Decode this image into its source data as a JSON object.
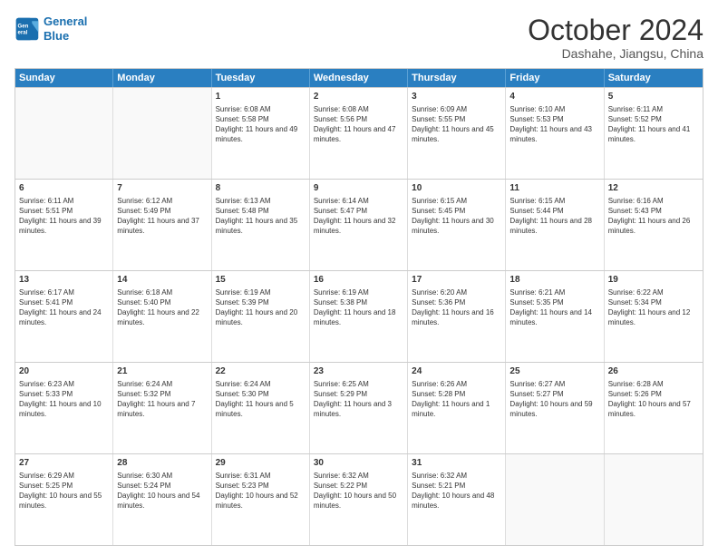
{
  "header": {
    "logo_line1": "General",
    "logo_line2": "Blue",
    "title": "October 2024",
    "subtitle": "Dashahe, Jiangsu, China"
  },
  "days_of_week": [
    "Sunday",
    "Monday",
    "Tuesday",
    "Wednesday",
    "Thursday",
    "Friday",
    "Saturday"
  ],
  "weeks": [
    [
      {
        "day": "",
        "sunrise": "",
        "sunset": "",
        "daylight": ""
      },
      {
        "day": "",
        "sunrise": "",
        "sunset": "",
        "daylight": ""
      },
      {
        "day": "1",
        "sunrise": "Sunrise: 6:08 AM",
        "sunset": "Sunset: 5:58 PM",
        "daylight": "Daylight: 11 hours and 49 minutes."
      },
      {
        "day": "2",
        "sunrise": "Sunrise: 6:08 AM",
        "sunset": "Sunset: 5:56 PM",
        "daylight": "Daylight: 11 hours and 47 minutes."
      },
      {
        "day": "3",
        "sunrise": "Sunrise: 6:09 AM",
        "sunset": "Sunset: 5:55 PM",
        "daylight": "Daylight: 11 hours and 45 minutes."
      },
      {
        "day": "4",
        "sunrise": "Sunrise: 6:10 AM",
        "sunset": "Sunset: 5:53 PM",
        "daylight": "Daylight: 11 hours and 43 minutes."
      },
      {
        "day": "5",
        "sunrise": "Sunrise: 6:11 AM",
        "sunset": "Sunset: 5:52 PM",
        "daylight": "Daylight: 11 hours and 41 minutes."
      }
    ],
    [
      {
        "day": "6",
        "sunrise": "Sunrise: 6:11 AM",
        "sunset": "Sunset: 5:51 PM",
        "daylight": "Daylight: 11 hours and 39 minutes."
      },
      {
        "day": "7",
        "sunrise": "Sunrise: 6:12 AM",
        "sunset": "Sunset: 5:49 PM",
        "daylight": "Daylight: 11 hours and 37 minutes."
      },
      {
        "day": "8",
        "sunrise": "Sunrise: 6:13 AM",
        "sunset": "Sunset: 5:48 PM",
        "daylight": "Daylight: 11 hours and 35 minutes."
      },
      {
        "day": "9",
        "sunrise": "Sunrise: 6:14 AM",
        "sunset": "Sunset: 5:47 PM",
        "daylight": "Daylight: 11 hours and 32 minutes."
      },
      {
        "day": "10",
        "sunrise": "Sunrise: 6:15 AM",
        "sunset": "Sunset: 5:45 PM",
        "daylight": "Daylight: 11 hours and 30 minutes."
      },
      {
        "day": "11",
        "sunrise": "Sunrise: 6:15 AM",
        "sunset": "Sunset: 5:44 PM",
        "daylight": "Daylight: 11 hours and 28 minutes."
      },
      {
        "day": "12",
        "sunrise": "Sunrise: 6:16 AM",
        "sunset": "Sunset: 5:43 PM",
        "daylight": "Daylight: 11 hours and 26 minutes."
      }
    ],
    [
      {
        "day": "13",
        "sunrise": "Sunrise: 6:17 AM",
        "sunset": "Sunset: 5:41 PM",
        "daylight": "Daylight: 11 hours and 24 minutes."
      },
      {
        "day": "14",
        "sunrise": "Sunrise: 6:18 AM",
        "sunset": "Sunset: 5:40 PM",
        "daylight": "Daylight: 11 hours and 22 minutes."
      },
      {
        "day": "15",
        "sunrise": "Sunrise: 6:19 AM",
        "sunset": "Sunset: 5:39 PM",
        "daylight": "Daylight: 11 hours and 20 minutes."
      },
      {
        "day": "16",
        "sunrise": "Sunrise: 6:19 AM",
        "sunset": "Sunset: 5:38 PM",
        "daylight": "Daylight: 11 hours and 18 minutes."
      },
      {
        "day": "17",
        "sunrise": "Sunrise: 6:20 AM",
        "sunset": "Sunset: 5:36 PM",
        "daylight": "Daylight: 11 hours and 16 minutes."
      },
      {
        "day": "18",
        "sunrise": "Sunrise: 6:21 AM",
        "sunset": "Sunset: 5:35 PM",
        "daylight": "Daylight: 11 hours and 14 minutes."
      },
      {
        "day": "19",
        "sunrise": "Sunrise: 6:22 AM",
        "sunset": "Sunset: 5:34 PM",
        "daylight": "Daylight: 11 hours and 12 minutes."
      }
    ],
    [
      {
        "day": "20",
        "sunrise": "Sunrise: 6:23 AM",
        "sunset": "Sunset: 5:33 PM",
        "daylight": "Daylight: 11 hours and 10 minutes."
      },
      {
        "day": "21",
        "sunrise": "Sunrise: 6:24 AM",
        "sunset": "Sunset: 5:32 PM",
        "daylight": "Daylight: 11 hours and 7 minutes."
      },
      {
        "day": "22",
        "sunrise": "Sunrise: 6:24 AM",
        "sunset": "Sunset: 5:30 PM",
        "daylight": "Daylight: 11 hours and 5 minutes."
      },
      {
        "day": "23",
        "sunrise": "Sunrise: 6:25 AM",
        "sunset": "Sunset: 5:29 PM",
        "daylight": "Daylight: 11 hours and 3 minutes."
      },
      {
        "day": "24",
        "sunrise": "Sunrise: 6:26 AM",
        "sunset": "Sunset: 5:28 PM",
        "daylight": "Daylight: 11 hours and 1 minute."
      },
      {
        "day": "25",
        "sunrise": "Sunrise: 6:27 AM",
        "sunset": "Sunset: 5:27 PM",
        "daylight": "Daylight: 10 hours and 59 minutes."
      },
      {
        "day": "26",
        "sunrise": "Sunrise: 6:28 AM",
        "sunset": "Sunset: 5:26 PM",
        "daylight": "Daylight: 10 hours and 57 minutes."
      }
    ],
    [
      {
        "day": "27",
        "sunrise": "Sunrise: 6:29 AM",
        "sunset": "Sunset: 5:25 PM",
        "daylight": "Daylight: 10 hours and 55 minutes."
      },
      {
        "day": "28",
        "sunrise": "Sunrise: 6:30 AM",
        "sunset": "Sunset: 5:24 PM",
        "daylight": "Daylight: 10 hours and 54 minutes."
      },
      {
        "day": "29",
        "sunrise": "Sunrise: 6:31 AM",
        "sunset": "Sunset: 5:23 PM",
        "daylight": "Daylight: 10 hours and 52 minutes."
      },
      {
        "day": "30",
        "sunrise": "Sunrise: 6:32 AM",
        "sunset": "Sunset: 5:22 PM",
        "daylight": "Daylight: 10 hours and 50 minutes."
      },
      {
        "day": "31",
        "sunrise": "Sunrise: 6:32 AM",
        "sunset": "Sunset: 5:21 PM",
        "daylight": "Daylight: 10 hours and 48 minutes."
      },
      {
        "day": "",
        "sunrise": "",
        "sunset": "",
        "daylight": ""
      },
      {
        "day": "",
        "sunrise": "",
        "sunset": "",
        "daylight": ""
      }
    ]
  ]
}
